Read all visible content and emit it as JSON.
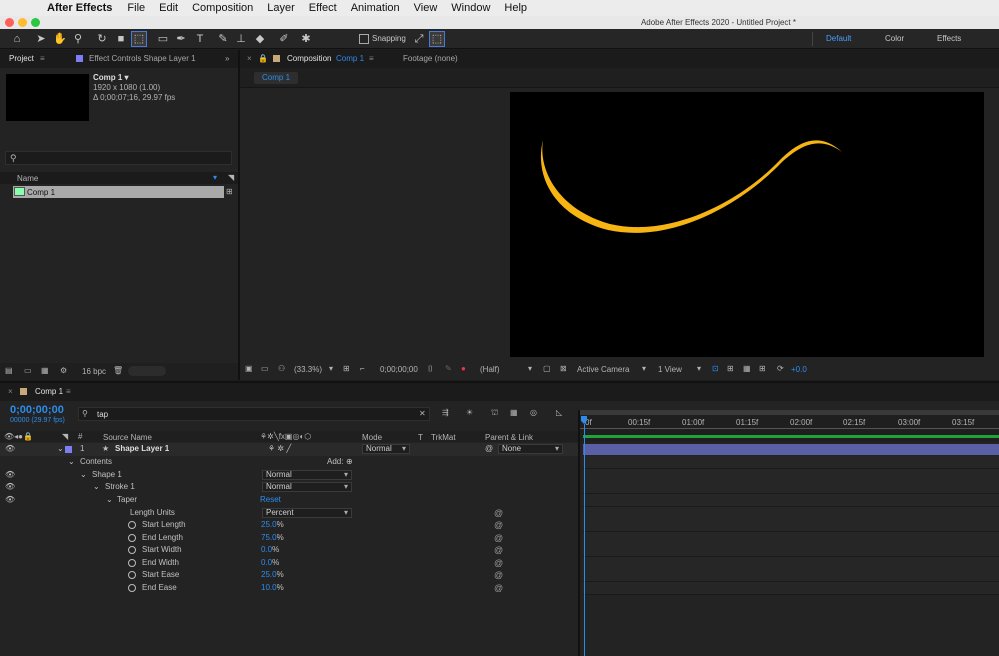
{
  "menubar": {
    "app_name": "After Effects",
    "items": [
      "File",
      "Edit",
      "Composition",
      "Layer",
      "Effect",
      "Animation",
      "View",
      "Window",
      "Help"
    ]
  },
  "window_title": "Adobe After Effects 2020 - Untitled Project *",
  "toolbar": {
    "snapping_label": "Snapping",
    "workspaces": [
      "Default",
      "Color",
      "Effects"
    ]
  },
  "project_panel": {
    "tab_project": "Project",
    "tab_effect_controls": "Effect Controls Shape Layer 1",
    "comp_name": "Comp 1 ▾",
    "comp_size": "1920 x 1080 (1.00)",
    "comp_duration": "Δ 0;00;07;16, 29.97 fps",
    "col_name": "Name",
    "item_name": "Comp 1",
    "bpc": "16 bpc"
  },
  "comp_panel": {
    "tab_composition": "Composition",
    "tab_composition_name": "Comp 1",
    "tab_footage": "Footage (none)",
    "subtab": "Comp 1",
    "zoom": "(33.3%)",
    "timecode": "0;00;00;00",
    "resolution": "(Half)",
    "camera": "Active Camera",
    "views": "1 View",
    "exposure": "+0.0"
  },
  "timeline": {
    "tab": "Comp 1",
    "timecode": "0;00;00;00",
    "fps": "00000 (29.97 fps)",
    "search_value": "tap",
    "headers": {
      "source_name": "Source Name",
      "mode": "Mode",
      "t": "T",
      "trkmat": "TrkMat",
      "parent": "Parent & Link"
    },
    "ruler": [
      "0f",
      "00:15f",
      "01:00f",
      "01:15f",
      "02:00f",
      "02:15f",
      "03:00f",
      "03:15f"
    ],
    "layer": {
      "index": "1",
      "name": "Shape Layer 1",
      "mode": "Normal",
      "parent": "None"
    },
    "rows": {
      "contents": "Contents",
      "add": "Add:",
      "shape1": "Shape 1",
      "shape1_mode": "Normal",
      "stroke1": "Stroke 1",
      "stroke1_mode": "Normal",
      "taper": "Taper",
      "reset": "Reset",
      "length_units": "Length Units",
      "length_units_value": "Percent"
    },
    "properties": [
      {
        "name": "Start Length",
        "value": "25.0",
        "unit": "%"
      },
      {
        "name": "End Length",
        "value": "75.0",
        "unit": "%"
      },
      {
        "name": "Start Width",
        "value": "0.0",
        "unit": "%"
      },
      {
        "name": "End Width",
        "value": "0.0",
        "unit": "%"
      },
      {
        "name": "Start Ease",
        "value": "25.0",
        "unit": "%"
      },
      {
        "name": "End Ease",
        "value": "10.0",
        "unit": "%"
      }
    ]
  },
  "colors": {
    "accent_blue": "#2d8ceb",
    "stroke_yellow": "#f7b514",
    "layer_bar": "#5a5fa6",
    "label_purple": "#7d7ef2",
    "label_tan": "#c8a878"
  }
}
